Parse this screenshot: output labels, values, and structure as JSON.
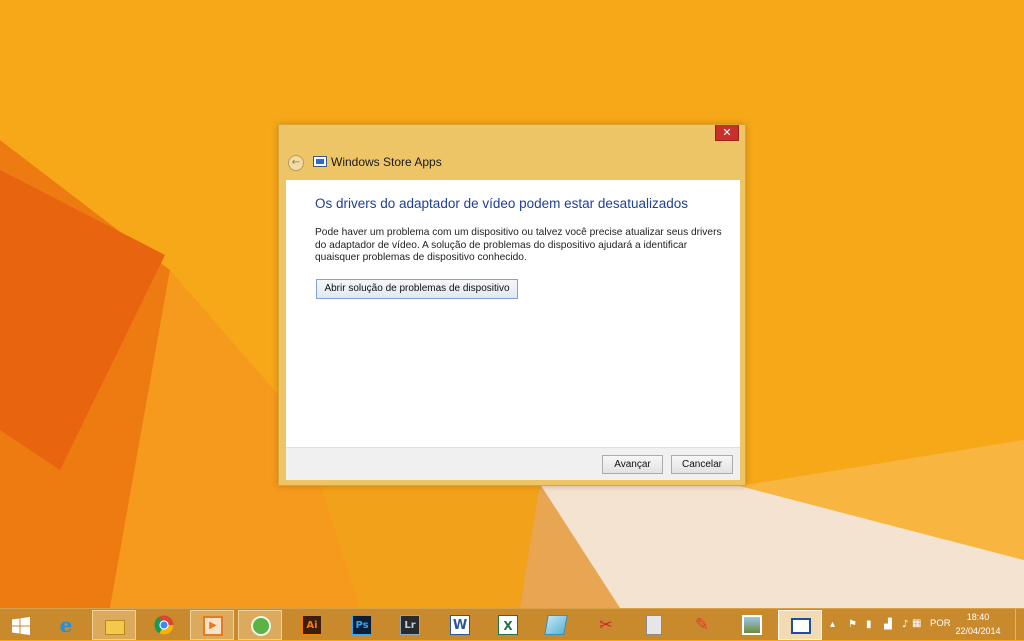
{
  "window": {
    "title": "Windows Store Apps",
    "close_label": "✕",
    "back_label": "←"
  },
  "main": {
    "heading": "Os drivers do adaptador de vídeo podem estar desatualizados",
    "description": "Pode haver um problema com um dispositivo ou talvez você precise atualizar seus drivers do adaptador de vídeo.  A solução de problemas do dispositivo ajudará a identificar quaisquer problemas de dispositivo conhecido.",
    "troubleshoot_button": "Abrir solução de problemas de dispositivo"
  },
  "footer": {
    "next_label": "Avançar",
    "cancel_label": "Cancelar"
  },
  "taskbar": {
    "items": [
      {
        "name": "start-icon",
        "label": "",
        "color": "#FFFFFF"
      },
      {
        "name": "internet-explorer-icon",
        "label": "e",
        "color": "#1E90E0"
      },
      {
        "name": "file-explorer-icon",
        "label": "",
        "color": "#F3C84B"
      },
      {
        "name": "chrome-icon",
        "label": "",
        "color": "#DB4437"
      },
      {
        "name": "media-player-icon",
        "label": "▶",
        "color": "#E87A1E"
      },
      {
        "name": "camtasia-icon",
        "label": "",
        "color": "#5BB346"
      },
      {
        "name": "illustrator-icon",
        "label": "Ai",
        "color": "#FF7C00"
      },
      {
        "name": "photoshop-icon",
        "label": "Ps",
        "color": "#31A8FF"
      },
      {
        "name": "lightroom-icon",
        "label": "Lr",
        "color": "#B9D2E8"
      },
      {
        "name": "word-icon",
        "label": "W",
        "color": "#2B579A"
      },
      {
        "name": "excel-icon",
        "label": "X",
        "color": "#217346"
      },
      {
        "name": "notes-icon",
        "label": "",
        "color": "#7EC8E3"
      },
      {
        "name": "snipping-tool-icon",
        "label": "✂",
        "color": "#C8202F"
      },
      {
        "name": "calculator-icon",
        "label": "",
        "color": "#D9D9D9"
      },
      {
        "name": "paint-icon",
        "label": "✎",
        "color": "#E23B2E"
      },
      {
        "name": "photo-viewer-icon",
        "label": "",
        "color": "#6E8B3D"
      },
      {
        "name": "troubleshooter-icon",
        "label": "",
        "color": "#1F4E9C"
      }
    ]
  },
  "tray": {
    "language": "POR",
    "time": "18:40",
    "date": "22/04/2014",
    "icons": [
      "chevron-up-icon",
      "flag-icon",
      "battery-icon",
      "signal-icon",
      "volume-icon",
      "keyboard-icon"
    ]
  },
  "colors": {
    "wallpaper": "#F6A818",
    "heading": "#1F3F9C",
    "close": "#C7312A"
  }
}
